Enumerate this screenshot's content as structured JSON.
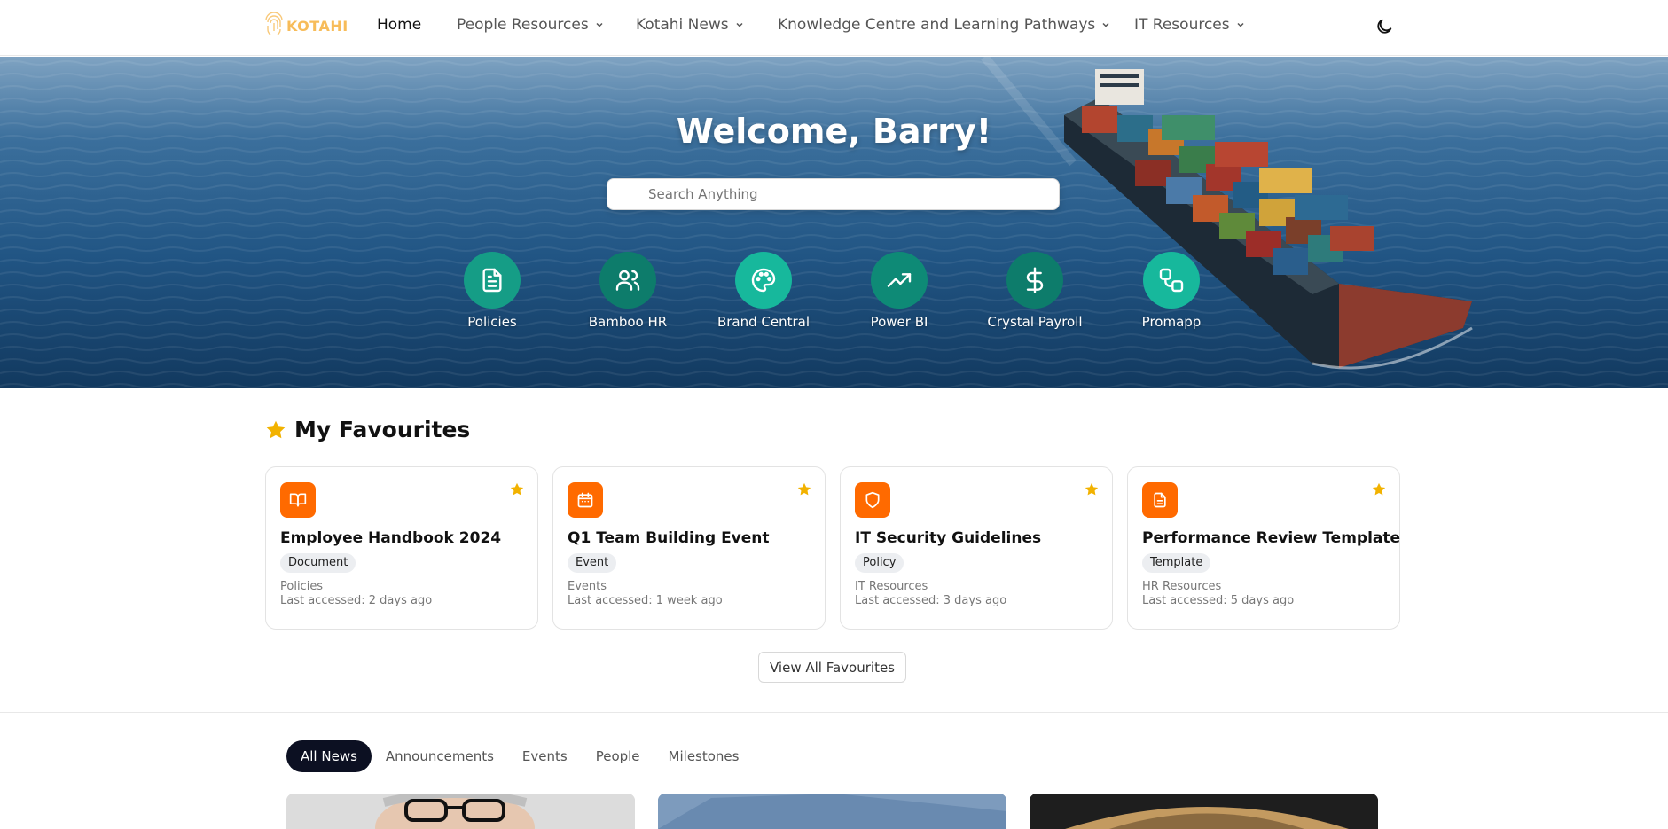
{
  "nav": {
    "logo_text": "KOTAHI",
    "items": [
      {
        "label": "Home",
        "active": true,
        "has_dropdown": false
      },
      {
        "label": "People Resources",
        "active": false,
        "has_dropdown": true
      },
      {
        "label": "Kotahi News",
        "active": false,
        "has_dropdown": true
      },
      {
        "label": "Knowledge Centre and Learning Pathways",
        "active": false,
        "has_dropdown": true
      },
      {
        "label": "IT Resources",
        "active": false,
        "has_dropdown": true
      }
    ],
    "theme_icon": "moon-icon"
  },
  "hero": {
    "welcome": "Welcome, Barry!",
    "search_placeholder": "Search Anything",
    "shortcuts": [
      {
        "label": "Policies",
        "icon": "document-icon",
        "color": "#159d86"
      },
      {
        "label": "Bamboo HR",
        "icon": "users-icon",
        "color": "#0d7c6b"
      },
      {
        "label": "Brand Central",
        "icon": "palette-icon",
        "color": "#17b89c"
      },
      {
        "label": "Power BI",
        "icon": "trending-up-icon",
        "color": "#0e8a76"
      },
      {
        "label": "Crystal Payroll",
        "icon": "dollar-icon",
        "color": "#0d7c6b"
      },
      {
        "label": "Promapp",
        "icon": "workflow-icon",
        "color": "#17b89c"
      }
    ]
  },
  "favourites": {
    "title": "My Favourites",
    "cards": [
      {
        "title": "Employee Handbook 2024",
        "tag": "Document",
        "category": "Policies",
        "accessed": "Last accessed: 2 days ago",
        "icon": "book-open-icon"
      },
      {
        "title": "Q1 Team Building Event",
        "tag": "Event",
        "category": "Events",
        "accessed": "Last accessed: 1 week ago",
        "icon": "calendar-icon"
      },
      {
        "title": "IT Security Guidelines",
        "tag": "Policy",
        "category": "IT Resources",
        "accessed": "Last accessed: 3 days ago",
        "icon": "shield-icon"
      },
      {
        "title": "Performance Review Template",
        "tag": "Template",
        "category": "HR Resources",
        "accessed": "Last accessed: 5 days ago",
        "icon": "file-text-icon"
      }
    ],
    "view_all": "View All Favourites"
  },
  "news": {
    "tabs": [
      {
        "label": "All News",
        "active": true
      },
      {
        "label": "Announcements",
        "active": false
      },
      {
        "label": "Events",
        "active": false
      },
      {
        "label": "People",
        "active": false
      },
      {
        "label": "Milestones",
        "active": false
      }
    ]
  },
  "colors": {
    "accent_orange": "#ff6a00",
    "star": "#f2b200",
    "teal": "#17b89c"
  }
}
